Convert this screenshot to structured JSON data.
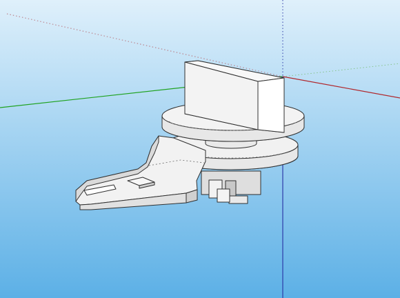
{
  "viewport": {
    "view": "3d-modeling-viewport",
    "background": {
      "top": "#dff0fb",
      "bottom": "#5cb0e6"
    },
    "axes": {
      "red": "#b0272c",
      "green": "#1fa21f",
      "blue": "#2d3aa8",
      "dotted_red": "#b7727a",
      "dotted_green": "#86c48c"
    },
    "model": {
      "name": "mechanical-part-with-fork-arm",
      "fill_light": "#f2f2f2",
      "fill_mid": "#e0e0e0",
      "fill_dark": "#c8c8c8",
      "edge": "#2f2f2f"
    }
  }
}
